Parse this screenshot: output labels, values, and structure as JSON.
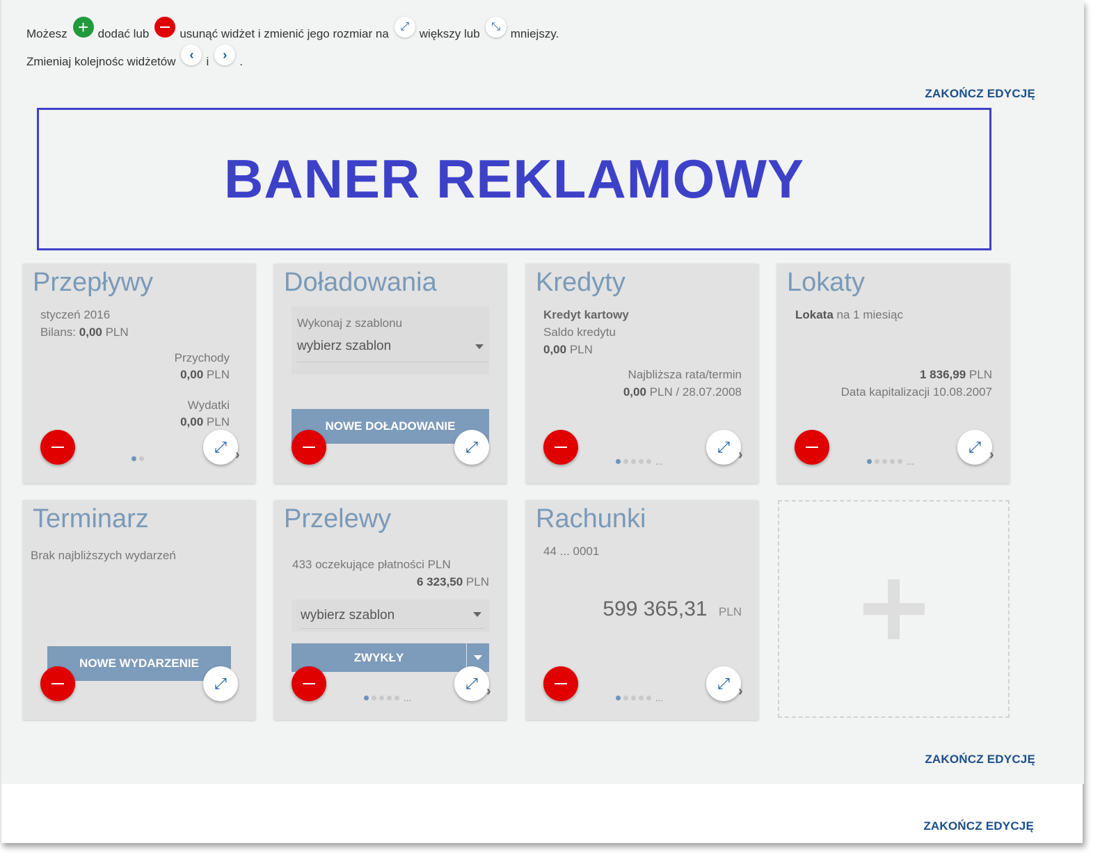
{
  "help": {
    "line1": [
      "Możesz",
      "dodać lub",
      "usunąć widżet i zmienić jego rozmiar na",
      "większy lub",
      "mniejszy."
    ],
    "line2": [
      "Zmieniaj kolejnośc widżetów",
      "i",
      "."
    ]
  },
  "actions": {
    "finish_edit": "ZAKOŃCZ EDYCJĘ"
  },
  "banner": {
    "text": "BANER REKLAMOWY"
  },
  "widgets": {
    "przeplywy": {
      "title": "Przepływy",
      "period": "styczeń 2016",
      "balance_label": "Bilans:",
      "balance_value": "0,00",
      "currency": "PLN",
      "income_label": "Przychody",
      "income_value": "0,00",
      "expenses_label": "Wydatki",
      "expenses_value": "0,00"
    },
    "doladowania": {
      "title": "Doładowania",
      "template_label": "Wykonaj z szablonu",
      "template_select": "wybierz szablon",
      "new_button": "NOWE DOŁADOWANIE"
    },
    "kredyty": {
      "title": "Kredyty",
      "product": "Kredyt kartowy",
      "saldo_label": "Saldo kredytu",
      "saldo_value": "0,00",
      "currency": "PLN",
      "next_label": "Najbliższa rata/termin",
      "next_value": "0,00",
      "next_rest": "PLN / 28.07.2008"
    },
    "lokaty": {
      "title": "Lokaty",
      "product_bold": "Lokata",
      "product_rest": "na 1 miesiąc",
      "amount": "1 836,99",
      "currency": "PLN",
      "capitalization": "Data kapitalizacji 10.08.2007"
    },
    "terminarz": {
      "title": "Terminarz",
      "empty": "Brak najbliższych wydarzeń",
      "new_button": "NOWE WYDARZENIE"
    },
    "przelewy": {
      "title": "Przelewy",
      "pending": "433 oczekujące płatności PLN",
      "pending_amount": "6 323,50",
      "currency": "PLN",
      "template_select": "wybierz szablon",
      "split_button": "ZWYKŁY"
    },
    "rachunki": {
      "title": "Rachunki",
      "account": "44 ... 0001",
      "balance": "599 365,31",
      "currency": "PLN"
    }
  },
  "colors": {
    "accent_blue": "#1b4f8a",
    "title_blue": "#7a9ab8",
    "banner_blue": "#3d41c8",
    "remove_red": "#e00000",
    "add_green": "#1f9a3c",
    "button_blue": "#7d9bba"
  },
  "icons": [
    "plus-circle-icon",
    "minus-circle-icon",
    "expand-icon",
    "shrink-icon",
    "chevron-left-icon",
    "chevron-right-icon"
  ]
}
